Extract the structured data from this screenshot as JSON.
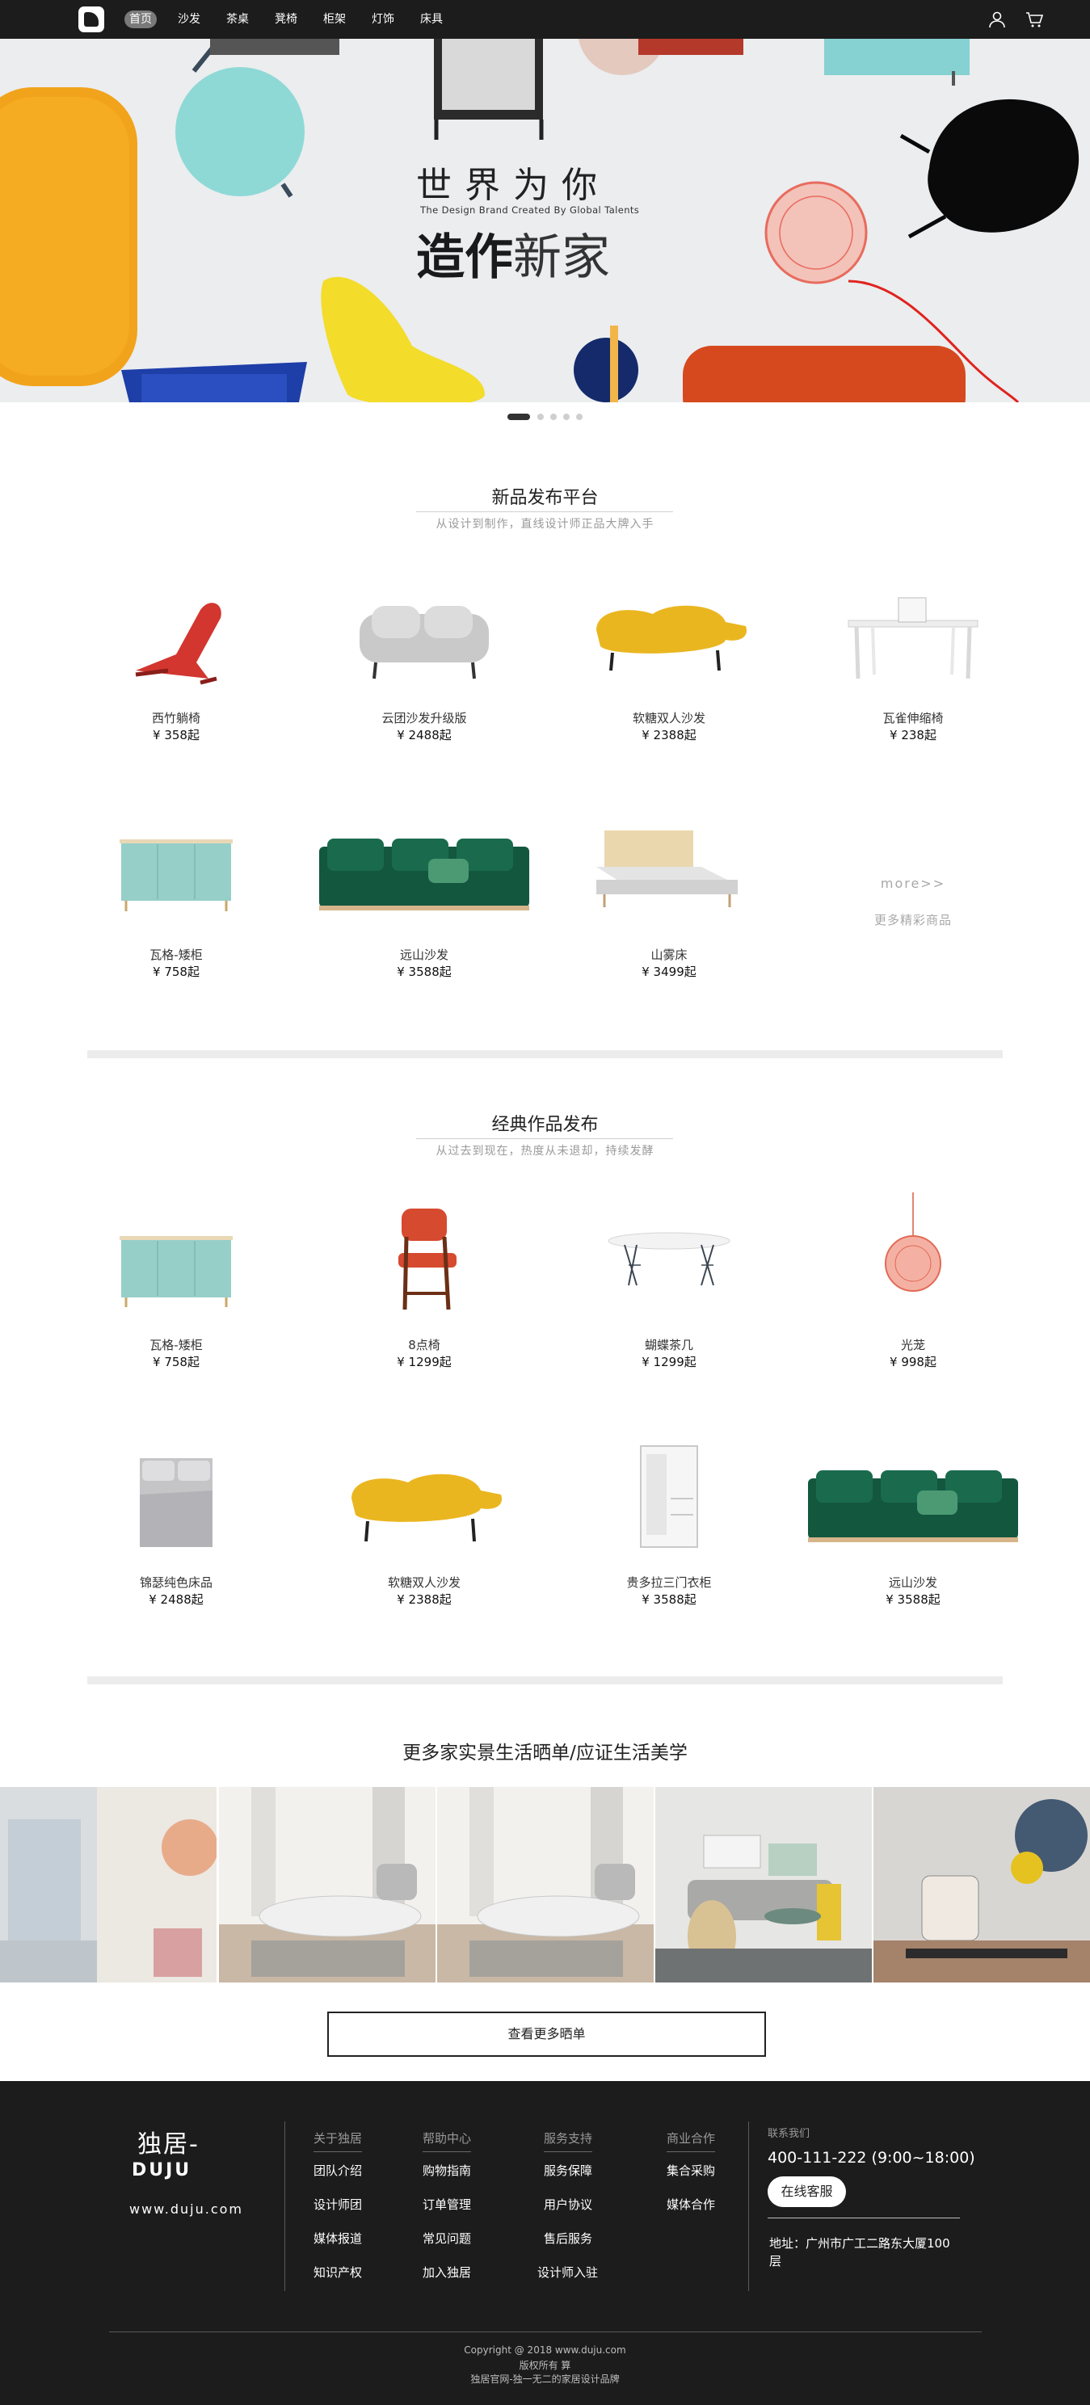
{
  "nav": {
    "items": [
      "首页",
      "沙发",
      "茶桌",
      "凳椅",
      "柜架",
      "灯饰",
      "床具"
    ],
    "user_icon": "user-icon",
    "cart_icon": "cart-icon"
  },
  "banner": {
    "headline_top": "世界为你",
    "tagline": "The Design Brand Created By Global Talents",
    "headline_bold": "造作",
    "headline_light": "新家",
    "slides_total": 5,
    "active_slide": 1
  },
  "new_products": {
    "title": "新品发布平台",
    "subtitle": "从设计到制作，直线设计师正品大牌入手",
    "items": [
      {
        "name": "西竹躺椅",
        "price": "¥ 358起"
      },
      {
        "name": "云团沙发升级版",
        "price": "¥ 2488起"
      },
      {
        "name": "软糖双人沙发",
        "price": "¥ 2388起"
      },
      {
        "name": "瓦雀伸缩椅",
        "price": "¥ 238起"
      },
      {
        "name": "瓦格-矮柜",
        "price": "¥ 758起"
      },
      {
        "name": "远山沙发",
        "price": "¥ 3588起"
      },
      {
        "name": "山雾床",
        "price": "¥ 3499起"
      }
    ],
    "more_label": "more>>",
    "more_desc": "更多精彩商品"
  },
  "classic": {
    "title": "经典作品发布",
    "subtitle": "从过去到现在，热度从未退却，持续发酵",
    "items": [
      {
        "name": "瓦格-矮柜",
        "price": "¥ 758起"
      },
      {
        "name": "8点椅",
        "price": "¥ 1299起"
      },
      {
        "name": "蝴蝶茶几",
        "price": "¥ 1299起"
      },
      {
        "name": "光茏",
        "price": "¥ 998起"
      },
      {
        "name": "锦瑟纯色床品",
        "price": "¥ 2488起"
      },
      {
        "name": "软糖双人沙发",
        "price": "¥ 2388起"
      },
      {
        "name": "贵多拉三门衣柜",
        "price": "¥ 3588起"
      },
      {
        "name": "远山沙发",
        "price": "¥ 3588起"
      }
    ]
  },
  "gallery": {
    "title": "更多家实景生活晒单/应证生活美学",
    "view_more": "查看更多晒单"
  },
  "footer": {
    "brand_cn": "独居-",
    "brand_en": "DUJU",
    "url": "www.duju.com",
    "columns": [
      {
        "title": "关于独居",
        "links": [
          "团队介绍",
          "设计师团",
          "媒体报道",
          "知识产权"
        ]
      },
      {
        "title": "帮助中心",
        "links": [
          "购物指南",
          "订单管理",
          "常见问题",
          "加入独居"
        ]
      },
      {
        "title": "服务支持",
        "links": [
          "服务保障",
          "用户协议",
          "售后服务",
          "设计师入驻"
        ]
      },
      {
        "title": "商业合作",
        "links": [
          "集合采购",
          "媒体合作"
        ]
      }
    ],
    "contact_label": "联系我们",
    "phone": "400-111-222   (9:00~18:00)",
    "chat_button": "在线客服",
    "address": "地址：广州市广工二路东大厦100层",
    "copyright": "Copyright @ 2018 www.duju.com",
    "rights": "版权所有 算",
    "slogan": "独居官网-独一无二的家居设计品牌"
  },
  "colors": {
    "nav_bg": "#1c1c1c",
    "footer_bg": "#1c1c1c",
    "active_nav": "#7a7a7a"
  }
}
